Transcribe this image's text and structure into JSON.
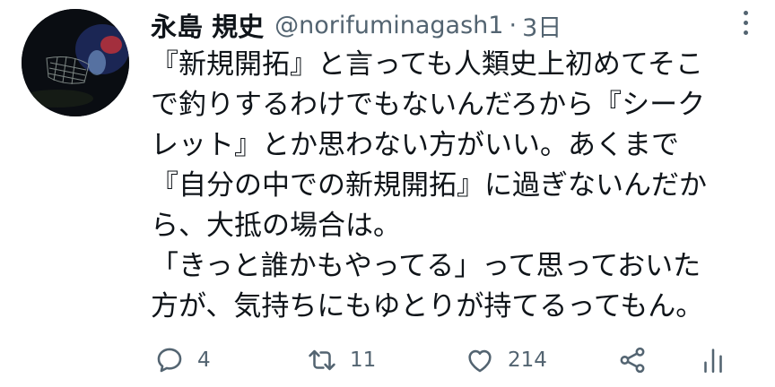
{
  "author": {
    "display_name": "永島 規史",
    "handle": "@norifuminagash1",
    "separator": "·",
    "time": "3日"
  },
  "tweet": {
    "lines": [
      "『新規開拓』と言っても人類史上初めてそこ",
      "で釣りするわけでもないんだろから『シーク",
      "レット』とか思わない方がいい。あくまで",
      "『自分の中での新規開拓』に過ぎないんだか",
      "ら、大抵の場合は。",
      "「きっと誰かもやってる」って思っておいた",
      "方が、気持ちにもゆとりが持てるってもん。"
    ]
  },
  "actions": {
    "reply": {
      "icon": "reply-icon",
      "count": "4"
    },
    "retweet": {
      "icon": "retweet-icon",
      "count": "11"
    },
    "like": {
      "icon": "heart-icon",
      "count": "214"
    },
    "share": {
      "icon": "share-icon"
    },
    "stats": {
      "icon": "analytics-icon"
    }
  },
  "colors": {
    "text": "#0f1419",
    "secondary": "#536471",
    "background": "#ffffff"
  }
}
